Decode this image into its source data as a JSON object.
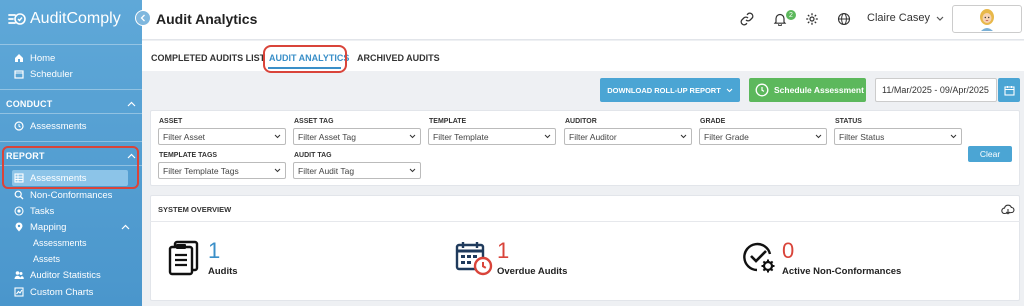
{
  "app": {
    "name": "AuditComply"
  },
  "sidebar": {
    "top_items": [
      {
        "label": "Home",
        "icon": "home-icon"
      },
      {
        "label": "Scheduler",
        "icon": "calendar-icon"
      }
    ],
    "conduct": {
      "title": "CONDUCT",
      "items": [
        {
          "label": "Assessments",
          "icon": "clock-icon"
        }
      ]
    },
    "report": {
      "title": "REPORT",
      "items": [
        {
          "label": "Assessments",
          "icon": "table-icon"
        },
        {
          "label": "Non-Conformances",
          "icon": "search-icon"
        },
        {
          "label": "Tasks",
          "icon": "target-icon"
        },
        {
          "label": "Mapping",
          "icon": "map-pin-icon"
        },
        {
          "label": "Auditor Statistics",
          "icon": "users-icon"
        },
        {
          "label": "Custom Charts",
          "icon": "chart-icon"
        }
      ],
      "mapping_sub": [
        "Assessments",
        "Assets"
      ]
    }
  },
  "header": {
    "title": "Audit Analytics",
    "notification_count": "2",
    "user_name": "Claire Casey"
  },
  "tabs": [
    {
      "label": "COMPLETED AUDITS LIST"
    },
    {
      "label": "AUDIT ANALYTICS"
    },
    {
      "label": "ARCHIVED AUDITS"
    }
  ],
  "toolbar": {
    "rollup_label": "DOWNLOAD ROLL-UP REPORT",
    "schedule_label": "Schedule Assessment",
    "date_range": "11/Mar/2025 - 09/Apr/2025"
  },
  "filters": {
    "asset": {
      "label": "ASSET",
      "placeholder": "Filter Asset"
    },
    "asset_tag": {
      "label": "ASSET TAG",
      "placeholder": "Filter Asset Tag"
    },
    "template": {
      "label": "TEMPLATE",
      "placeholder": "Filter Template"
    },
    "auditor": {
      "label": "AUDITOR",
      "placeholder": "Filter Auditor"
    },
    "grade": {
      "label": "GRADE",
      "placeholder": "Filter Grade"
    },
    "status": {
      "label": "STATUS",
      "placeholder": "Filter Status"
    },
    "template_tags": {
      "label": "TEMPLATE TAGS",
      "placeholder": "Filter Template Tags"
    },
    "audit_tag": {
      "label": "AUDIT TAG",
      "placeholder": "Filter Audit Tag"
    },
    "clear_label": "Clear"
  },
  "overview": {
    "title": "SYSTEM OVERVIEW",
    "stats": [
      {
        "value": "1",
        "label": "Audits",
        "color": "#3a8fc8",
        "icon": "clipboard-icon"
      },
      {
        "value": "1",
        "label": "Overdue Audits",
        "color": "#d9443a",
        "icon": "overdue-calendar-icon"
      },
      {
        "value": "0",
        "label": "Active Non-Conformances",
        "color": "#d9443a",
        "icon": "check-gear-icon"
      }
    ]
  },
  "colors": {
    "accent": "#3a8fc8",
    "success": "#5cb85c",
    "danger": "#d9443a",
    "sidebar": "#4a96cc"
  }
}
